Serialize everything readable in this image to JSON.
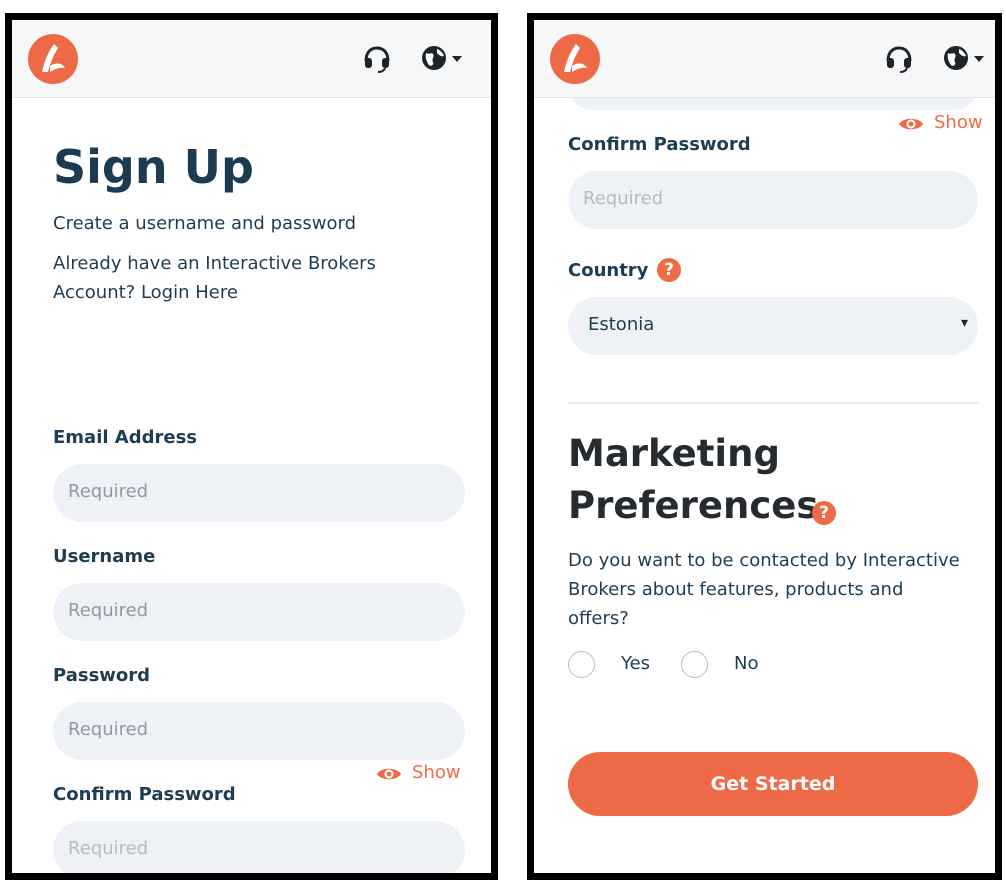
{
  "left_screen": {
    "title": "Sign Up",
    "subtitle": "Create a username and password",
    "login_line1": "Already have an Interactive Brokers",
    "login_line2": "Account? Login Here",
    "email_label": "Email Address",
    "email_placeholder": "Required",
    "username_label": "Username",
    "username_placeholder": "Required",
    "password_label": "Password",
    "password_placeholder": "Required",
    "show_label": "Show",
    "confirm_label": "Confirm Password",
    "confirm_placeholder": "Required"
  },
  "right_screen": {
    "show_label": "Show",
    "confirm_label": "Confirm Password",
    "confirm_placeholder": "Required",
    "country_label": "Country",
    "country_help": "?",
    "country_value": "Estonia",
    "dropdown_caret": "▾",
    "marketing_title_line1": "Marketing",
    "marketing_title_line2": "Preferences",
    "marketing_help": "?",
    "question_line1": "Do you want to be contacted by Interactive",
    "question_line2": "Brokers about features, products and",
    "question_line3": "offers?",
    "option_yes": "Yes",
    "option_no": "No",
    "submit_label": "Get Started"
  },
  "icons": {
    "logo": "brand-logo-icon",
    "support": "headset-icon",
    "language": "globe-icon",
    "show": "eye-icon"
  },
  "colors": {
    "brand": "#ee6a47",
    "field_bg": "#eef1f6",
    "heading": "#1c3a50"
  }
}
